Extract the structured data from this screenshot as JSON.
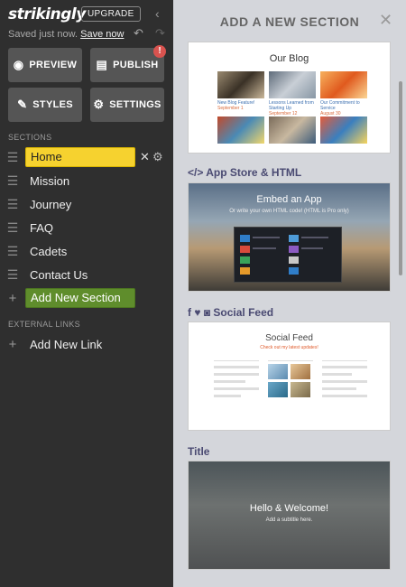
{
  "app": {
    "logo": "strikingly",
    "upgrade": "UPGRADE",
    "saved_text": "Saved just now.",
    "save_now": "Save now"
  },
  "toolbar": {
    "preview": "PREVIEW",
    "publish": "PUBLISH",
    "styles": "STYLES",
    "settings": "SETTINGS",
    "publish_badge": "!"
  },
  "sidebar": {
    "sections_label": "SECTIONS",
    "sections": [
      {
        "label": "Home",
        "active": true
      },
      {
        "label": "Mission"
      },
      {
        "label": "Journey"
      },
      {
        "label": "FAQ"
      },
      {
        "label": "Cadets"
      },
      {
        "label": "Contact Us"
      }
    ],
    "add_section": "Add New Section",
    "external_label": "EXTERNAL LINKS",
    "add_link": "Add New Link"
  },
  "panel": {
    "title": "ADD A NEW SECTION",
    "blog_card": {
      "title": "Our Blog",
      "posts": [
        {
          "title": "New Blog Feature!",
          "date": "September 1"
        },
        {
          "title": "Lessons Learned from Starting Up",
          "date": "September 12"
        },
        {
          "title": "Our Commitment to Service",
          "date": "August 30"
        }
      ]
    },
    "app_category": "</> App Store & HTML",
    "app_card": {
      "title": "Embed an App",
      "subtitle": "Or write your own HTML code! (HTML is Pro only)"
    },
    "social_category": "Social Feed",
    "social_card": {
      "title": "Social Feed",
      "subtitle": "Check out my latest updates!"
    },
    "title_category": "Title",
    "title_card": {
      "title": "Hello & Welcome!",
      "subtitle": "Add a subtitle here."
    }
  },
  "colors": {
    "sidebar_bg": "#2f2f2f",
    "panel_bg": "#d4d6db",
    "active_section": "#f6d22f",
    "add_section": "#5f8d2c",
    "category_text": "#4a4a72",
    "publish_badge": "#d9534f"
  },
  "icons": {
    "preview": "eye-icon",
    "publish": "document-icon",
    "styles": "brush-icon",
    "settings": "gear-icon"
  }
}
